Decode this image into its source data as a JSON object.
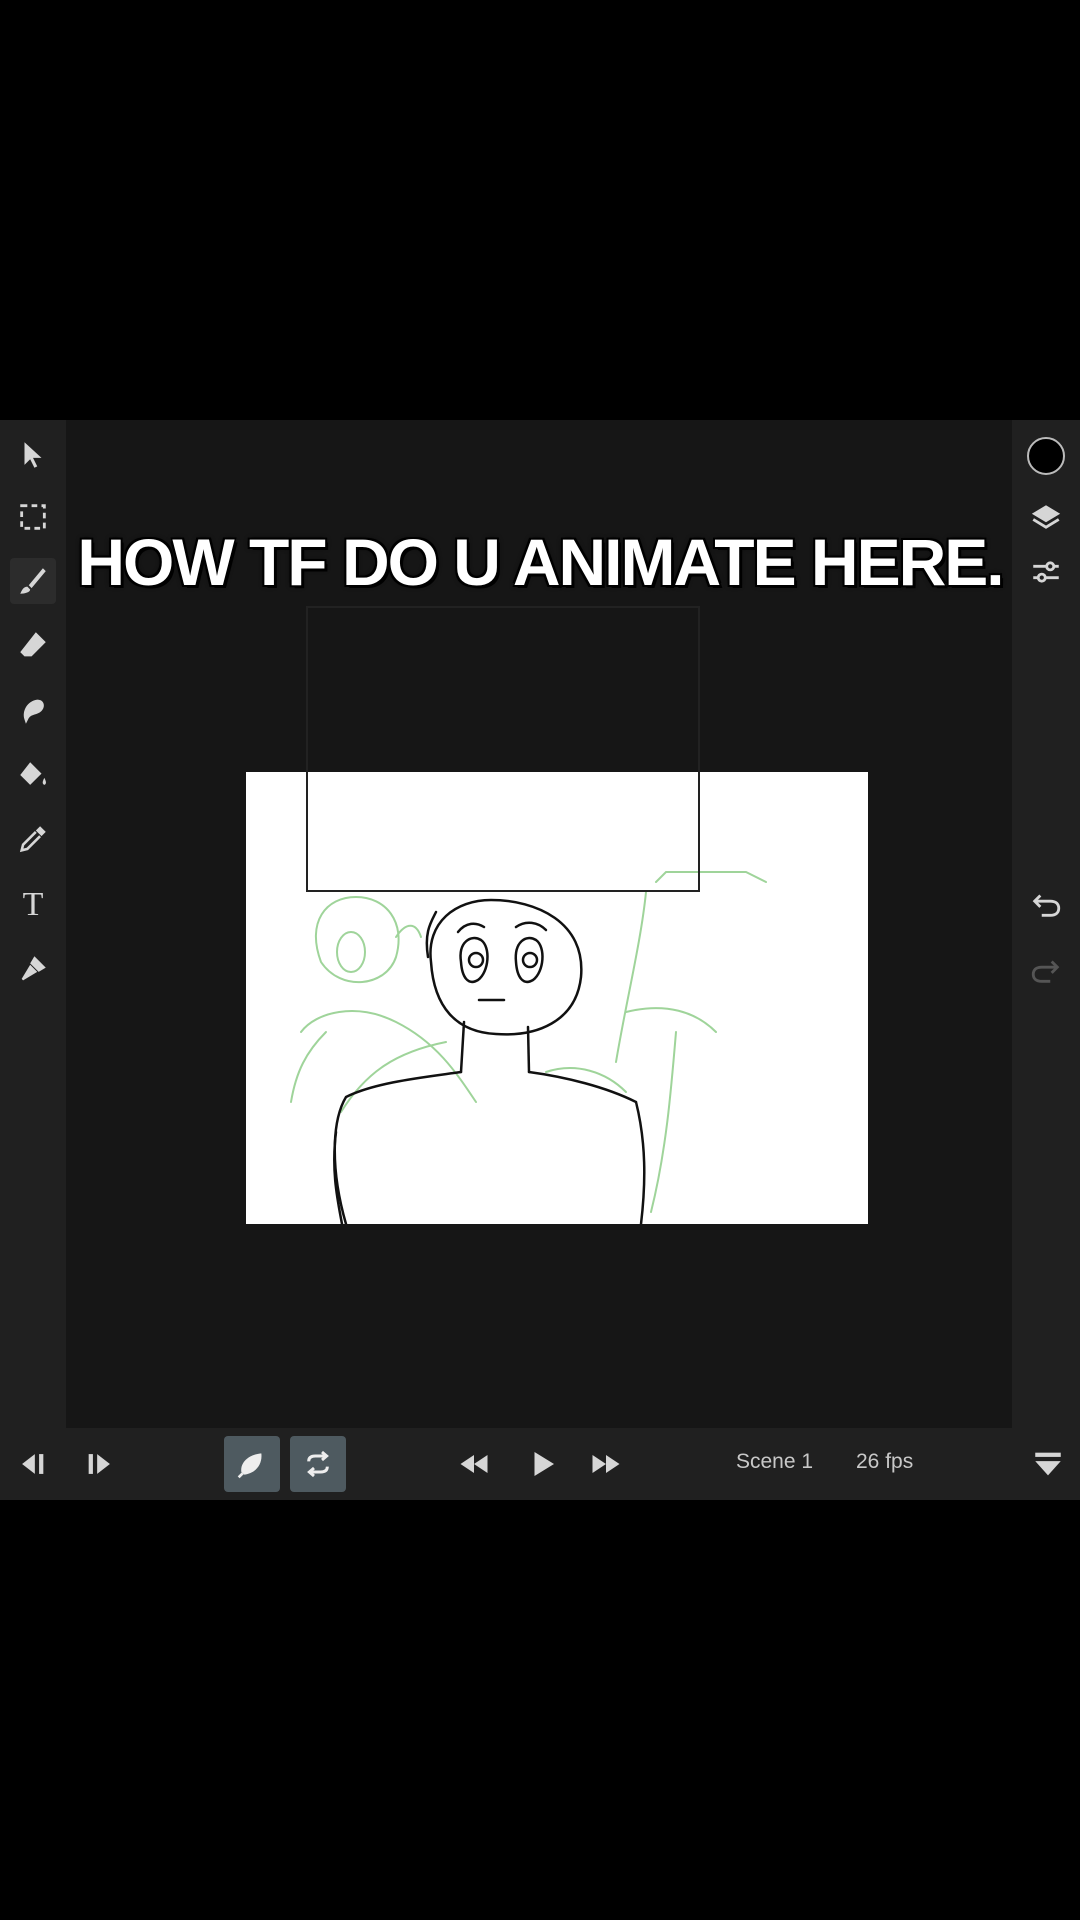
{
  "caption": "HOW TF DO U ANIMATE HERE.",
  "left_tools": [
    {
      "name": "select-arrow-icon"
    },
    {
      "name": "marquee-select-icon"
    },
    {
      "name": "brush-icon"
    },
    {
      "name": "eraser-icon"
    },
    {
      "name": "smudge-icon"
    },
    {
      "name": "fill-bucket-icon"
    },
    {
      "name": "eyedropper-icon"
    },
    {
      "name": "text-tool-icon",
      "glyph": "T"
    },
    {
      "name": "pen-tool-icon"
    }
  ],
  "right_tools": [
    {
      "name": "color-swatch",
      "color": "#000000"
    },
    {
      "name": "layers-icon"
    },
    {
      "name": "adjustments-icon"
    },
    {
      "name": "undo-icon"
    },
    {
      "name": "redo-icon"
    }
  ],
  "playback": {
    "scene_label": "Scene 1",
    "fps_label": "26 fps"
  },
  "colors": {
    "accent_toggle": "#4e5a60",
    "sketch_green": "#9fd49a",
    "ink": "#111111"
  }
}
